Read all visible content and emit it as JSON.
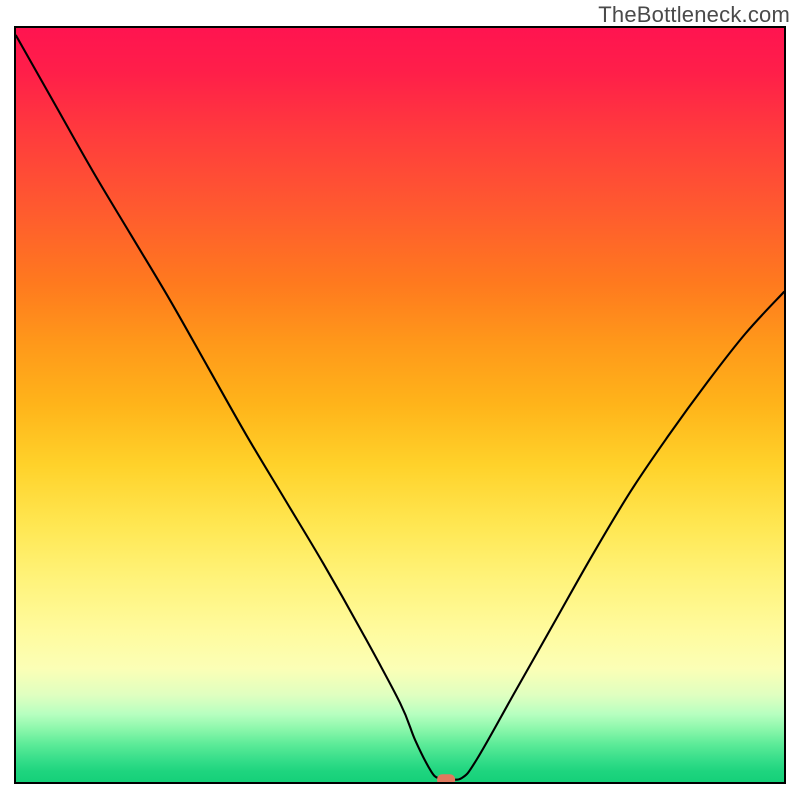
{
  "watermark": "TheBottleneck.com",
  "chart_data": {
    "type": "line",
    "title": "",
    "xlabel": "",
    "ylabel": "",
    "xlim": [
      0,
      100
    ],
    "ylim": [
      0,
      100
    ],
    "grid": false,
    "legend": false,
    "x": [
      0,
      5,
      10,
      15,
      20,
      25,
      30,
      35,
      40,
      45,
      50,
      52,
      54,
      55,
      56,
      58,
      60,
      65,
      70,
      75,
      80,
      85,
      90,
      95,
      100
    ],
    "values": [
      99,
      90,
      81,
      72.5,
      64,
      55,
      46,
      37.5,
      29,
      20,
      10.5,
      5.5,
      1.5,
      0.5,
      0.5,
      0.5,
      3,
      12,
      21,
      30,
      38.5,
      46,
      53,
      59.5,
      65
    ],
    "marker": {
      "x": 56,
      "y": 0.3
    },
    "background": "vertical-rainbow-gradient"
  }
}
